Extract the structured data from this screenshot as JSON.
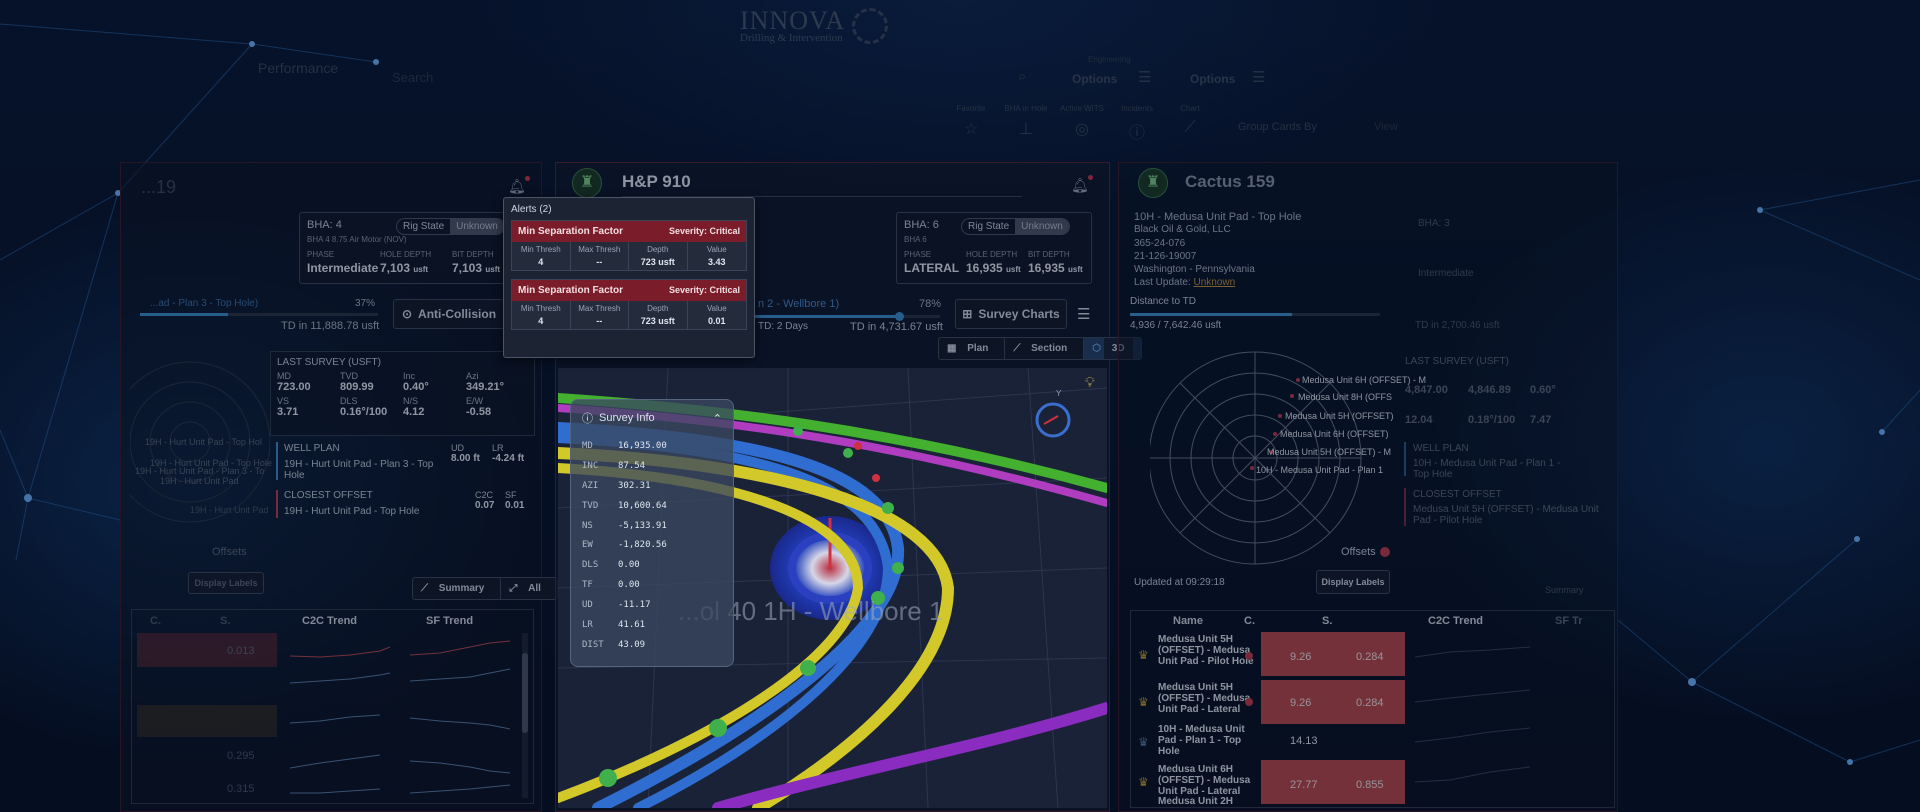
{
  "header": {
    "logo_text": "INNOVA",
    "logo_sub": "Drilling & Intervention",
    "performance": "Performance",
    "search_placeholder": "Search",
    "engineering_label": "Engineering",
    "options_1": "Options",
    "options_2": "Options",
    "toolbar": [
      {
        "label": "Favorite",
        "icon": "star-icon",
        "glyph": "☆"
      },
      {
        "label": "BHA in Hole",
        "icon": "bha-icon",
        "glyph": "⊥"
      },
      {
        "label": "Active WITS",
        "icon": "wits-icon",
        "glyph": "◎"
      },
      {
        "label": "Incidents",
        "icon": "incident-icon",
        "glyph": "ⓘ"
      },
      {
        "label": "Chart",
        "icon": "chart-icon",
        "glyph": "⟋"
      }
    ],
    "group_by": "Group Cards By",
    "view_label": "View"
  },
  "left_panel": {
    "rig": "...19",
    "bha": "BHA: 4",
    "bha_desc": "BHA 4 8.75 Air Motor (NOV)",
    "rig_state_label": "Rig State",
    "rig_state_value": "Unknown",
    "phase_label": "PHASE",
    "phase": "Intermediate",
    "hole_depth_label": "HOLE DEPTH",
    "hole_depth": "7,103",
    "bit_depth_label": "BIT DEPTH",
    "bit_depth": "7,103",
    "unit": "usft",
    "plan_text": "...ad - Plan 3 - Top Hole)",
    "progress_pct": "37%",
    "progress_value": 0.37,
    "td_text": "TD in 11,888.78 usft",
    "anti_collision": "Anti-Collision",
    "last_survey_title": "LAST SURVEY (USFT)",
    "last_survey": [
      {
        "k": "MD",
        "v": "723.00"
      },
      {
        "k": "TVD",
        "v": "809.99"
      },
      {
        "k": "Inc",
        "v": "0.40°"
      },
      {
        "k": "Azi",
        "v": "349.21°"
      },
      {
        "k": "VS",
        "v": "3.71"
      },
      {
        "k": "DLS",
        "v": "0.16°/100"
      },
      {
        "k": "N/S",
        "v": "4.12"
      },
      {
        "k": "E/W",
        "v": "-0.58"
      }
    ],
    "well_plan_title": "WELL PLAN",
    "well_plan": "19H - Hurt Unit Pad - Plan 3 - Top Hole",
    "ud_label": "UD",
    "ud": "8.00 ft",
    "lr_label": "LR",
    "lr": "-4.24 ft",
    "closest_title": "CLOSEST OFFSET",
    "closest": "19H - Hurt Unit Pad - Top Hole",
    "c2c_label": "C2C",
    "c2c": "0.07",
    "sf_label": "SF",
    "sf": "0.01",
    "offsets": "Offsets",
    "display_labels": "Display Labels",
    "summary_btn": "Summary",
    "all_btn": "All",
    "plot_labels": [
      "19H - Hurt Unit Pad - Top Hol",
      "19H - Hurt Unit Pad - Top Hole",
      "19H - Hurt Unit Pad - Plan 3 - To",
      "19H - Hurt Unit Pad",
      "19H - Hurt Unit Pad"
    ],
    "columns": [
      "C.",
      "S.",
      "C2C Trend",
      "SF Trend"
    ],
    "sf_values": [
      "0.013",
      "0.295",
      "0.315"
    ]
  },
  "mid_panel": {
    "rig": "H&P 910",
    "bha": "BHA: 6",
    "bha_desc": "BHA 6",
    "rig_state_label": "Rig State",
    "rig_state_value": "Unknown",
    "phase_label": "PHASE",
    "phase": "LATERAL",
    "hole_depth_label": "HOLE DEPTH",
    "hole_depth": "16,935",
    "bit_depth_label": "BIT DEPTH",
    "bit_depth": "16,935",
    "unit": "usft",
    "plan_text": "n 2 - Wellbore 1)",
    "progress_pct": "78%",
    "progress_value": 0.78,
    "td_days": "TD: 2 Days",
    "td_text": "TD in 4,731.67 usft",
    "survey_charts": "Survey Charts",
    "view_plan": "Plan",
    "view_section": "Section",
    "view_3d": "3D",
    "watermark": "...ol 40 1H - Wellbore 1",
    "survey_info_title": "Survey Info",
    "survey_info": [
      {
        "k": "MD",
        "v": "16,935.00"
      },
      {
        "k": "INC",
        "v": "87.54"
      },
      {
        "k": "AZI",
        "v": "302.31"
      },
      {
        "k": "TVD",
        "v": "10,600.64"
      },
      {
        "k": "NS",
        "v": "-5,133.91"
      },
      {
        "k": "EW",
        "v": "-1,820.56"
      },
      {
        "k": "DLS",
        "v": "0.00"
      },
      {
        "k": "TF",
        "v": "0.00"
      },
      {
        "k": "UD",
        "v": "-11.17"
      },
      {
        "k": "LR",
        "v": "41.61"
      },
      {
        "k": "DIST",
        "v": "43.09"
      }
    ]
  },
  "alerts": {
    "title": "Alerts (2)",
    "items": [
      {
        "name": "Min Separation Factor",
        "severity": "Severity: Critical",
        "min_thresh": "4",
        "max_thresh": "--",
        "depth": "723 usft",
        "value": "3.43"
      },
      {
        "name": "Min Separation Factor",
        "severity": "Severity: Critical",
        "min_thresh": "4",
        "max_thresh": "--",
        "depth": "723 usft",
        "value": "0.01"
      }
    ],
    "col_labels": [
      "Min Thresh",
      "Max Thresh",
      "Depth",
      "Value"
    ]
  },
  "right_panel": {
    "rig": "Cactus 159",
    "well": "10H - Medusa Unit Pad - Top Hole",
    "company": "Black Oil & Gold, LLC",
    "api": "365-24-076",
    "id2": "21-126-19007",
    "location": "Washington - Pennsylvania",
    "last_update_label": "Last Update:",
    "last_update": "Unknown",
    "distance_title": "Distance to TD",
    "distance": "4,936 / 7,642.46 usft",
    "distance_value": 0.646,
    "updated": "Updated at 09:29:18",
    "display_labels": "Display Labels",
    "offsets": "Offsets",
    "plot_labels": [
      "Medusa Unit 6H (OFFSET) - M",
      "Medusa Unit 8H (OFFS",
      "Medusa Unit 5H (OFFSET)",
      "Medusa Unit 6H (OFFSET)",
      "Medusa Unit 5H (OFFSET) - M",
      "10H - Medusa Unit Pad - Plan 1"
    ],
    "ghost_bha": "BHA: 3",
    "ghost_phase": "Intermediate",
    "ghost_td": "TD in 2,700.46 usft",
    "last_survey_title": "LAST SURVEY (USFT)",
    "ghost_md": "4,847.00",
    "ghost_tvd": "4,846.89",
    "ghost_inc": "0.60°",
    "ghost_vs": "12.04",
    "ghost_dls": "0.18°/100",
    "ghost_ns": "7.47",
    "well_plan_title": "WELL PLAN",
    "well_plan": "10H - Medusa Unit Pad - Plan 1 - Top Hole",
    "closest_title": "CLOSEST OFFSET",
    "closest": "Medusa Unit 5H (OFFSET) - Medusa Unit Pad - Pilot Hole",
    "columns": [
      "Name",
      "C.",
      "S.",
      "C2C Trend",
      "SF Tr"
    ],
    "rows": [
      {
        "name": "Medusa Unit 5H (OFFSET) - Medusa Unit Pad - Pilot Hole",
        "c": "9.26",
        "s": "0.284"
      },
      {
        "name": "Medusa Unit 5H (OFFSET) - Medusa Unit Pad - Lateral",
        "c": "9.26",
        "s": "0.284"
      },
      {
        "name": "10H - Medusa Unit Pad - Plan 1 - Top Hole",
        "c": "14.13",
        "s": ""
      },
      {
        "name": "Medusa Unit 6H (OFFSET) - Medusa Unit Pad - Lateral",
        "c": "27.77",
        "s": "0.855"
      },
      {
        "name": "Medusa Unit 2H",
        "c": "",
        "s": ""
      }
    ],
    "summary_btn": "Summary"
  },
  "colors": {
    "critical": "#7a1c2a",
    "accent": "#3d8fcf",
    "trend_red": "#b9474c"
  }
}
